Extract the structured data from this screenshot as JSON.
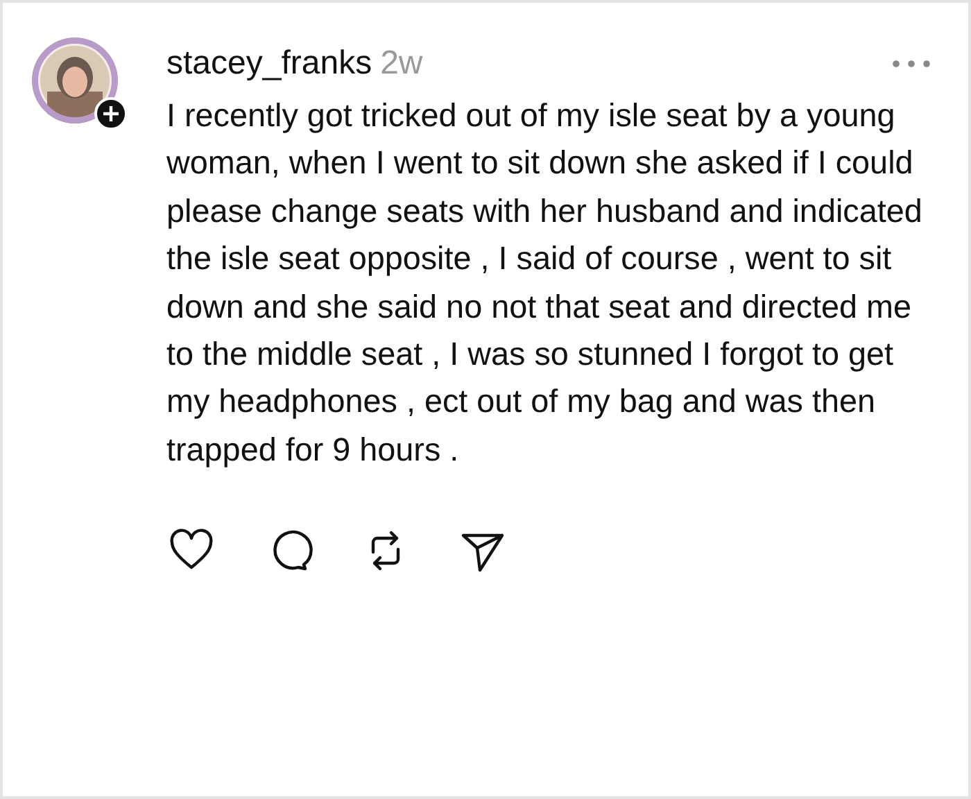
{
  "post": {
    "username": "stacey_franks",
    "time": "2w",
    "text": "I recently got tricked out of my isle seat by a young woman, when I went to sit down she asked if I could please change seats with her husband and indicated the isle seat opposite , I said of course , went to sit down and she said no not that seat and directed me to the middle seat , I was so stunned I forgot to get my headphones , ect out of my bag and was then trapped for 9 hours ."
  }
}
